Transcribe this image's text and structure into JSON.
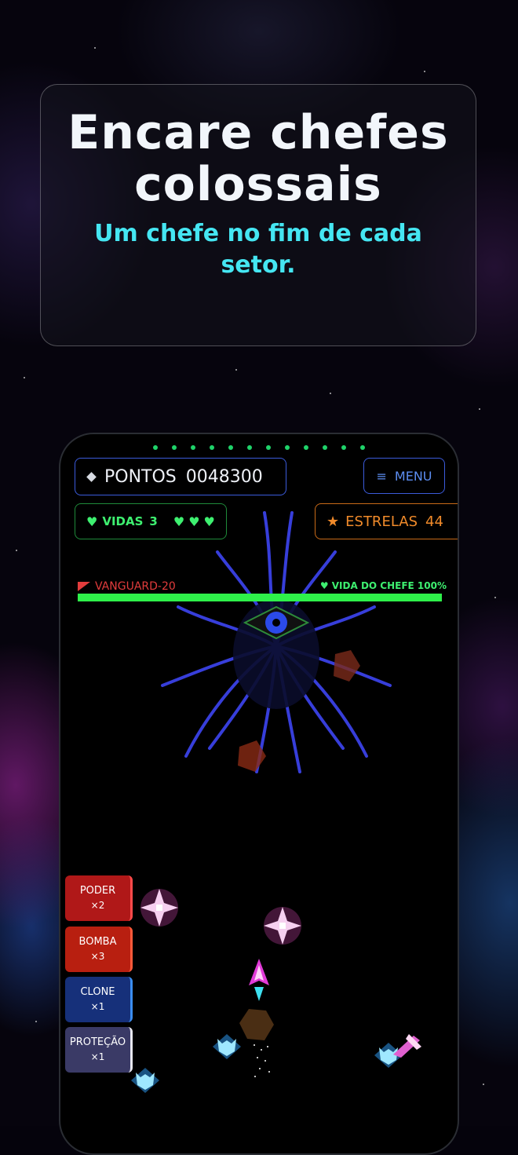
{
  "headline": {
    "title": "Encare chefes colossais",
    "subtitle": "Um chefe no fim de cada setor."
  },
  "hud": {
    "score_label": "PONTOS",
    "score_value": "0048300",
    "menu_label": "MENU",
    "lives_label": "VIDAS",
    "lives_count": "3",
    "lives_hearts": "♥♥♥",
    "stars_label": "ESTRELAS",
    "stars_value": "44"
  },
  "boss": {
    "name": "VANGUARD-20",
    "health_label": "VIDA DO CHEFE",
    "health_value": "100%",
    "health_fraction": 1.0
  },
  "powerups": [
    {
      "label": "PODER",
      "count": "×2",
      "color": "#b01818"
    },
    {
      "label": "BOMBA",
      "count": "×3",
      "color": "#b81f10"
    },
    {
      "label": "CLONE",
      "count": "×1",
      "color": "#16307a"
    },
    {
      "label": "PROTEÇÃO",
      "count": "×1",
      "color": "#3a3a66"
    }
  ],
  "colors": {
    "accent_cyan": "#45e6f2",
    "hud_blue": "#3b5bdb",
    "life_green": "#3ef070",
    "star_orange": "#f08a2a",
    "boss_red": "#e23c3c"
  }
}
